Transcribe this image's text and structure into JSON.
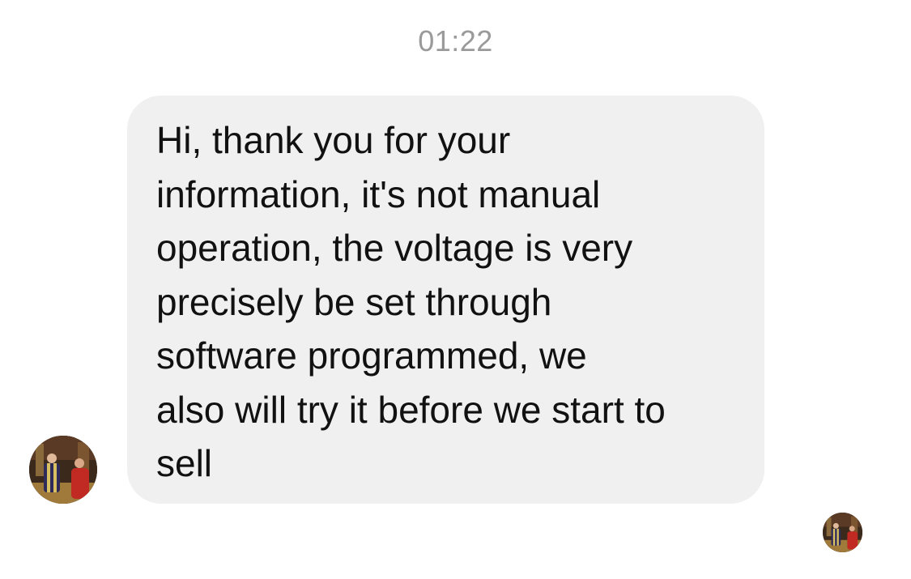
{
  "conversation": {
    "timestamp": "01:22",
    "messages": [
      {
        "direction": "incoming",
        "text": "Hi,   thank you for your\ninformation,   it's not manual\noperation,   the voltage is very\nprecisely be set through\nsoftware programmed,   we\nalso will try it before we start to\nsell",
        "sender_avatar": "profile-photo",
        "bubble_color": "#f0f0f0"
      }
    ],
    "read_receipt_avatar": "profile-photo"
  },
  "colors": {
    "timestamp": "#9a9a9a",
    "bubble_background": "#f0f0f0",
    "text": "#111111"
  }
}
